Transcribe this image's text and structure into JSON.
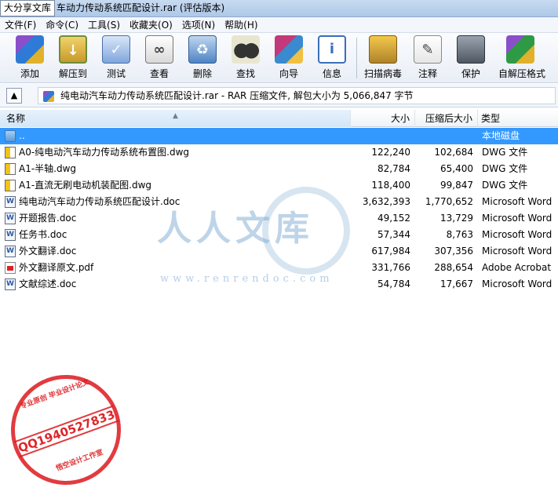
{
  "window": {
    "badge": "大分享文库",
    "title": "车动力传动系统匹配设计.rar (评估版本)"
  },
  "menu": [
    {
      "label": "文件(F)"
    },
    {
      "label": "命令(C)"
    },
    {
      "label": "工具(S)"
    },
    {
      "label": "收藏夹(O)"
    },
    {
      "label": "选项(N)"
    },
    {
      "label": "帮助(H)"
    }
  ],
  "toolbar": {
    "buttons": [
      {
        "label": "添加",
        "icon": "add-archive-icon"
      },
      {
        "label": "解压到",
        "icon": "extract-to-icon"
      },
      {
        "label": "测试",
        "icon": "test-icon"
      },
      {
        "label": "查看",
        "icon": "view-icon"
      },
      {
        "label": "删除",
        "icon": "delete-icon"
      },
      {
        "label": "查找",
        "icon": "find-icon"
      },
      {
        "label": "向导",
        "icon": "wizard-icon"
      },
      {
        "label": "信息",
        "icon": "info-icon"
      },
      {
        "label": "扫描病毒",
        "icon": "scan-virus-icon"
      },
      {
        "label": "注释",
        "icon": "comment-icon"
      },
      {
        "label": "保护",
        "icon": "protect-icon"
      },
      {
        "label": "自解压格式",
        "icon": "sfx-icon"
      }
    ]
  },
  "address": {
    "text": "纯电动汽车动力传动系统匹配设计.rar - RAR 压缩文件, 解包大小为 5,066,847 字节"
  },
  "columns": {
    "name": "名称",
    "size": "大小",
    "packed": "压缩后大小",
    "type": "类型"
  },
  "files": [
    {
      "name": "..",
      "size": "",
      "packed": "",
      "type": "本地磁盘",
      "kind": "folder"
    },
    {
      "name": "A0-纯电动汽车动力传动系统布置图.dwg",
      "size": "122,240",
      "packed": "102,684",
      "type": "DWG 文件",
      "kind": "dwg"
    },
    {
      "name": "A1-半轴.dwg",
      "size": "82,784",
      "packed": "65,400",
      "type": "DWG 文件",
      "kind": "dwg"
    },
    {
      "name": "A1-直流无刷电动机装配图.dwg",
      "size": "118,400",
      "packed": "99,847",
      "type": "DWG 文件",
      "kind": "dwg"
    },
    {
      "name": "纯电动汽车动力传动系统匹配设计.doc",
      "size": "3,632,393",
      "packed": "1,770,652",
      "type": "Microsoft Word",
      "kind": "doc"
    },
    {
      "name": "开题报告.doc",
      "size": "49,152",
      "packed": "13,729",
      "type": "Microsoft Word",
      "kind": "doc"
    },
    {
      "name": "任务书.doc",
      "size": "57,344",
      "packed": "8,763",
      "type": "Microsoft Word",
      "kind": "doc"
    },
    {
      "name": "外文翻译.doc",
      "size": "617,984",
      "packed": "307,356",
      "type": "Microsoft Word",
      "kind": "doc"
    },
    {
      "name": "外文翻译原文.pdf",
      "size": "331,766",
      "packed": "288,654",
      "type": "Adobe Acrobat",
      "kind": "pdf"
    },
    {
      "name": "文献综述.doc",
      "size": "54,784",
      "packed": "17,667",
      "type": "Microsoft Word",
      "kind": "doc"
    }
  ],
  "watermark": {
    "logo": "人人文库",
    "url": "www.renrendoc.com"
  },
  "stamp": {
    "top_text": "专业原创 毕业设计论文",
    "qq": "QQ1940527833",
    "bottom_text": "悟空设计工作室"
  },
  "colors": {
    "selection": "#3399ff",
    "watermark": "#6ea0cd",
    "stamp": "#dc191e"
  }
}
